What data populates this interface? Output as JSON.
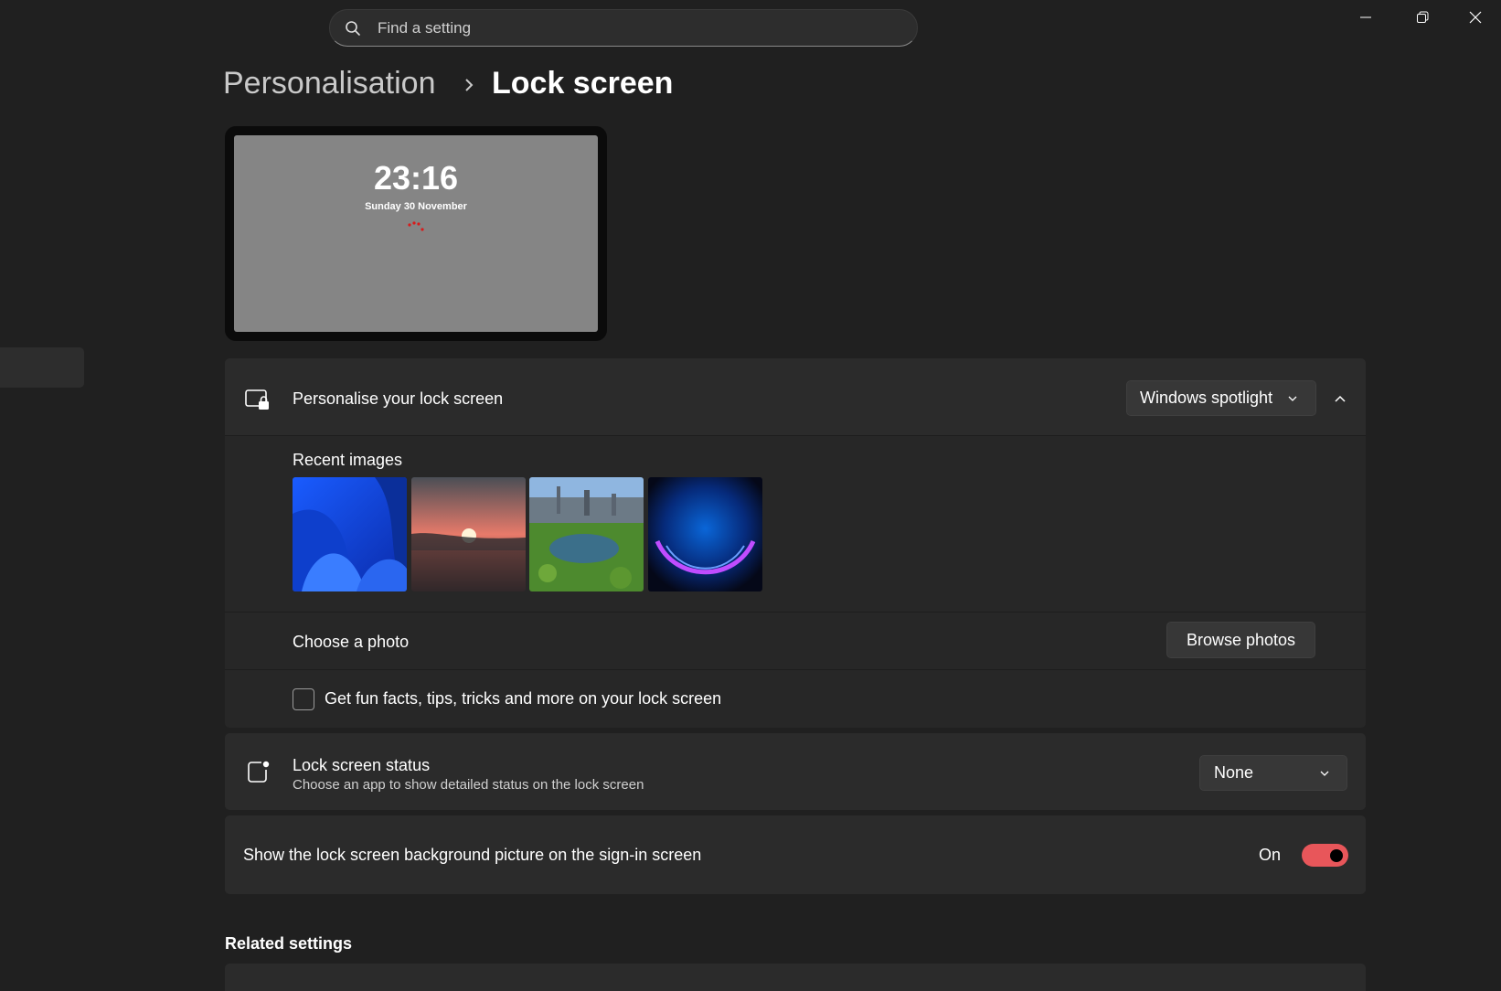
{
  "search": {
    "placeholder": "Find a setting"
  },
  "window_controls": {
    "minimize": "minimize-icon",
    "restore": "restore-icon",
    "close": "close-icon"
  },
  "breadcrumb": {
    "parent": "Personalisation",
    "current": "Lock screen"
  },
  "preview": {
    "time": "23:16",
    "date": "Sunday 30 November"
  },
  "personalise": {
    "label": "Personalise your lock screen",
    "dropdown_value": "Windows spotlight",
    "recent_images_label": "Recent images",
    "recent_images": [
      "blue-bloom-wallpaper",
      "sunset-lake-wallpaper",
      "city-park-aerial-wallpaper",
      "purple-orb-wallpaper"
    ],
    "choose_photo_label": "Choose a photo",
    "browse_button": "Browse photos",
    "fun_facts_label": "Get fun facts, tips, tricks and more on your lock screen",
    "fun_facts_checked": false
  },
  "status": {
    "label": "Lock screen status",
    "description": "Choose an app to show detailed status on the lock screen",
    "dropdown_value": "None"
  },
  "signin_bg": {
    "label": "Show the lock screen background picture on the sign-in screen",
    "state_label": "On",
    "enabled": true
  },
  "related": {
    "title": "Related settings"
  },
  "colors": {
    "accent": "#e8565a",
    "background": "#202020",
    "card": "#2b2b2b"
  }
}
